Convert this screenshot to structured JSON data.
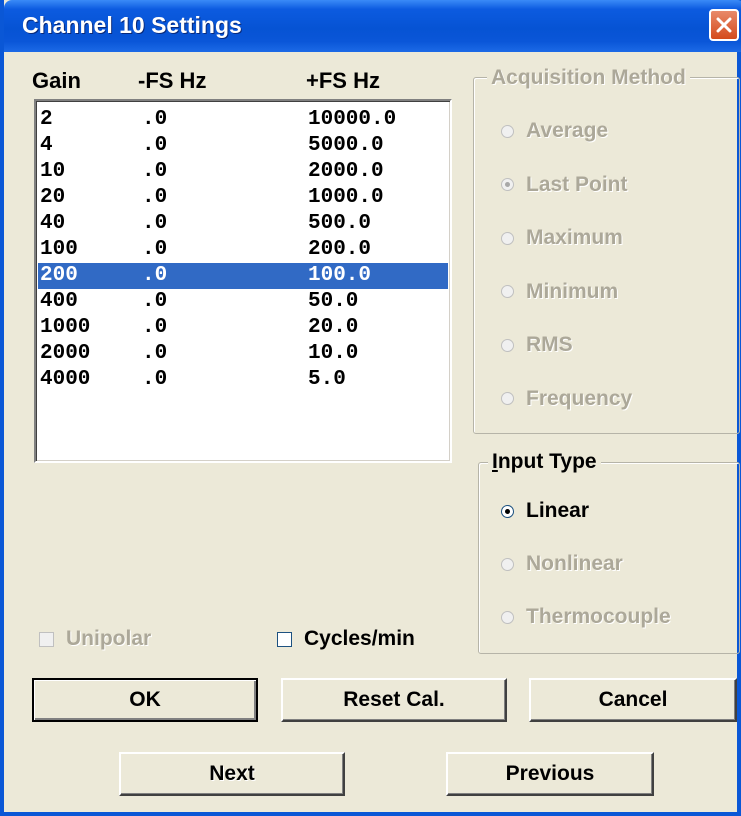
{
  "window": {
    "title": "Channel 10 Settings"
  },
  "list": {
    "headers": {
      "gain": "Gain",
      "neg": "-FS Hz",
      "pos": "+FS Hz"
    },
    "rows": [
      [
        "2",
        ".0",
        "10000.0"
      ],
      [
        "4",
        ".0",
        "5000.0"
      ],
      [
        "10",
        ".0",
        "2000.0"
      ],
      [
        "20",
        ".0",
        "1000.0"
      ],
      [
        "40",
        ".0",
        "500.0"
      ],
      [
        "100",
        ".0",
        "200.0"
      ],
      [
        "200",
        ".0",
        "100.0"
      ],
      [
        "400",
        ".0",
        "50.0"
      ],
      [
        "1000",
        ".0",
        "20.0"
      ],
      [
        "2000",
        ".0",
        "10.0"
      ],
      [
        "4000",
        ".0",
        "5.0"
      ]
    ],
    "selected_index": 6
  },
  "acquisition": {
    "title": "Acquisition Method",
    "options": [
      "Average",
      "Last Point",
      "Maximum",
      "Minimum",
      "RMS",
      "Frequency"
    ],
    "selected": "Last Point",
    "enabled": false
  },
  "input_type": {
    "title": "Input Type",
    "options": [
      "Linear",
      "Nonlinear",
      "Thermocouple"
    ],
    "selected": "Linear"
  },
  "checkboxes": {
    "unipolar": {
      "label": "Unipolar",
      "checked": false,
      "enabled": false
    },
    "cycles": {
      "label": "Cycles/min",
      "checked": false,
      "enabled": true
    }
  },
  "buttons": {
    "ok": "OK",
    "reset": "Reset Cal.",
    "cancel": "Cancel",
    "next": "Next",
    "previous": "Previous"
  },
  "colors": {
    "title_bar": "#0a57d6",
    "selection": "#316ac5",
    "dialog_bg": "#ece9d8",
    "disabled_text": "#aca899"
  }
}
